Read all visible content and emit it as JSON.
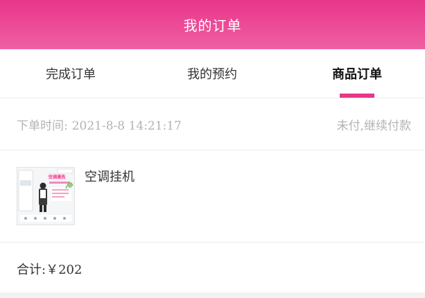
{
  "header": {
    "title": "我的订单"
  },
  "tabs": [
    {
      "label": "完成订单",
      "active": false
    },
    {
      "label": "我的预约",
      "active": false
    },
    {
      "label": "商品订单",
      "active": true
    }
  ],
  "order": {
    "time_label": "下单时间:",
    "time_value": "2021-8-8 14:21:17",
    "status": "未付,继续付款",
    "product": {
      "name": "空调挂机",
      "thumbnail_icon": "air-conditioner-ad-image",
      "thumbnail_text": "空调清洗"
    },
    "total_label": "合计:",
    "total_value": "￥202"
  },
  "colors": {
    "accent": "#e8368a",
    "muted_text": "#b3b3b3",
    "divider": "#ececec"
  }
}
